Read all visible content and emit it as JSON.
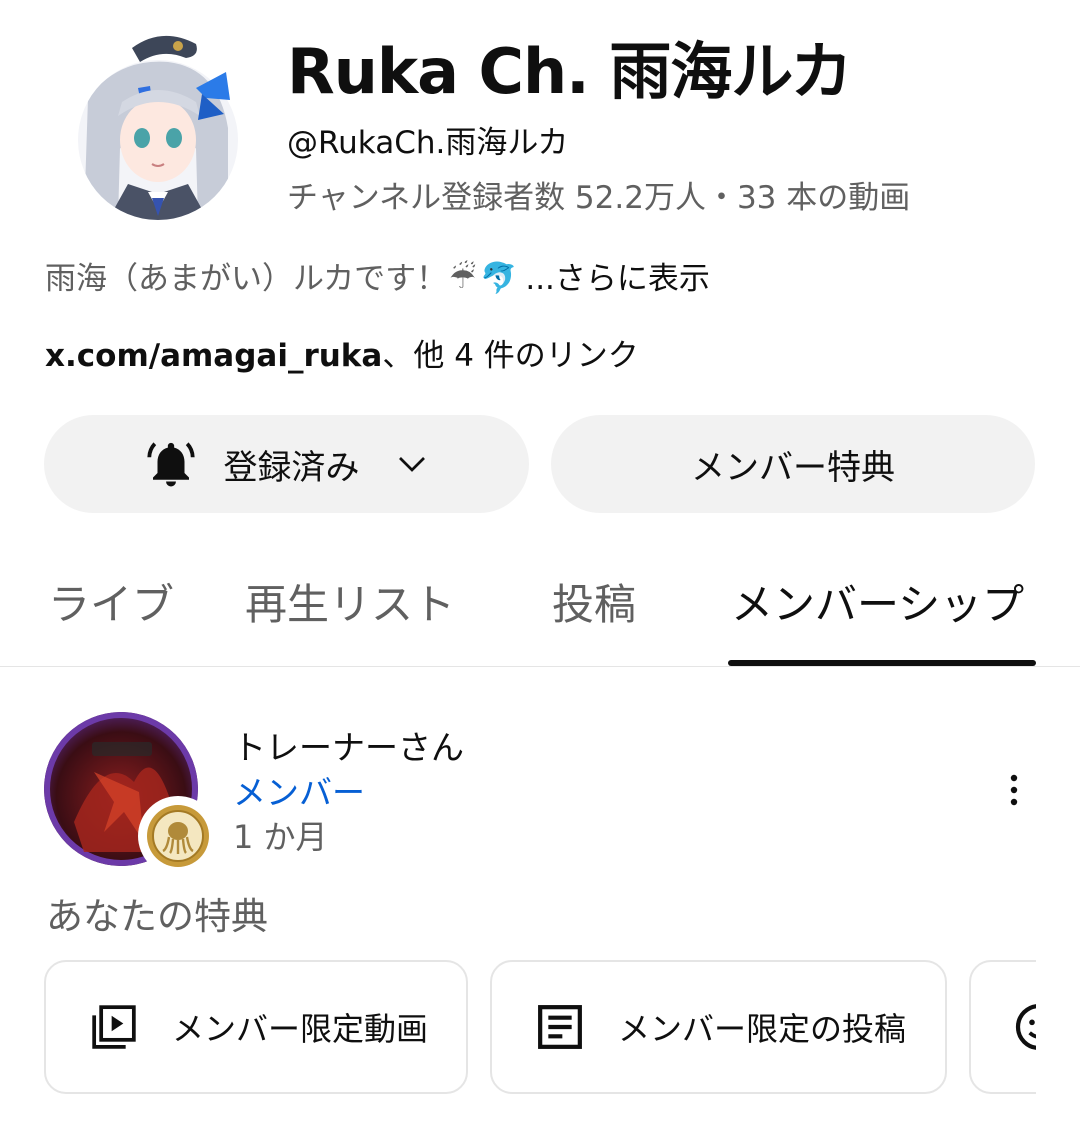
{
  "channel": {
    "name": "Ruka Ch. 雨海ルカ",
    "handle": "@RukaCh.雨海ルカ",
    "stats": "チャンネル登録者数 52.2万人・33 本の動画",
    "description": "雨海（あまがい）ルカです！",
    "description_emojis": [
      "☔",
      "🐬"
    ],
    "more_label": "...さらに表示",
    "link_url": "x.com/amagai_ruka",
    "link_suffix": "、他 4 件のリンク"
  },
  "actions": {
    "subscribed_label": "登録済み",
    "member_perks_label": "メンバー特典"
  },
  "tabs": [
    {
      "label": "ライブ",
      "active": false
    },
    {
      "label": "再生リスト",
      "active": false
    },
    {
      "label": "投稿",
      "active": false
    },
    {
      "label": "メンバーシップ",
      "active": true
    }
  ],
  "membership": {
    "user_name": "トレーナーさん",
    "status": "メンバー",
    "duration": "1 か月",
    "perks_title": "あなたの特典",
    "perks": [
      {
        "label": "メンバー限定動画",
        "icon": "video-library-icon"
      },
      {
        "label": "メンバー限定の投稿",
        "icon": "post-icon"
      },
      {
        "label": "",
        "icon": "emoji-icon"
      }
    ]
  },
  "colors": {
    "accent_link": "#065fd4",
    "secondary_text": "#606060",
    "button_bg": "#f2f2f2"
  }
}
